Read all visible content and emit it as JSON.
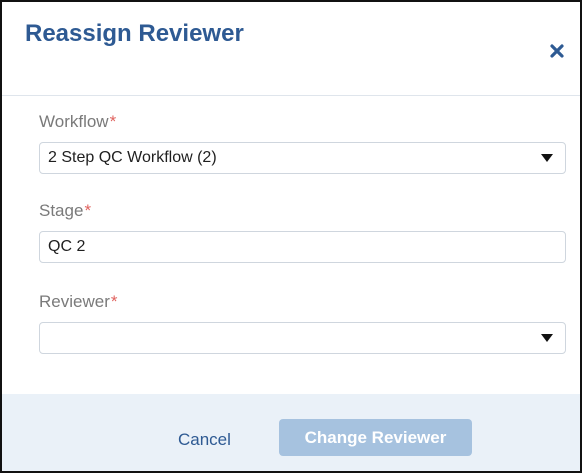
{
  "dialog": {
    "title": "Reassign Reviewer",
    "close_icon": "close-icon"
  },
  "fields": {
    "workflow": {
      "label": "Workflow",
      "required_mark": "*",
      "value": "2 Step QC Workflow (2)"
    },
    "stage": {
      "label": "Stage",
      "required_mark": "*",
      "value": "QC 2"
    },
    "reviewer": {
      "label": "Reviewer",
      "required_mark": "*",
      "value": ""
    }
  },
  "footer": {
    "cancel_label": "Cancel",
    "submit_label": "Change Reviewer"
  },
  "colors": {
    "title": "#2e5a93",
    "required": "#e0625e",
    "footer_bg": "#eaf1f8",
    "submit_disabled": "#a6c2df"
  }
}
